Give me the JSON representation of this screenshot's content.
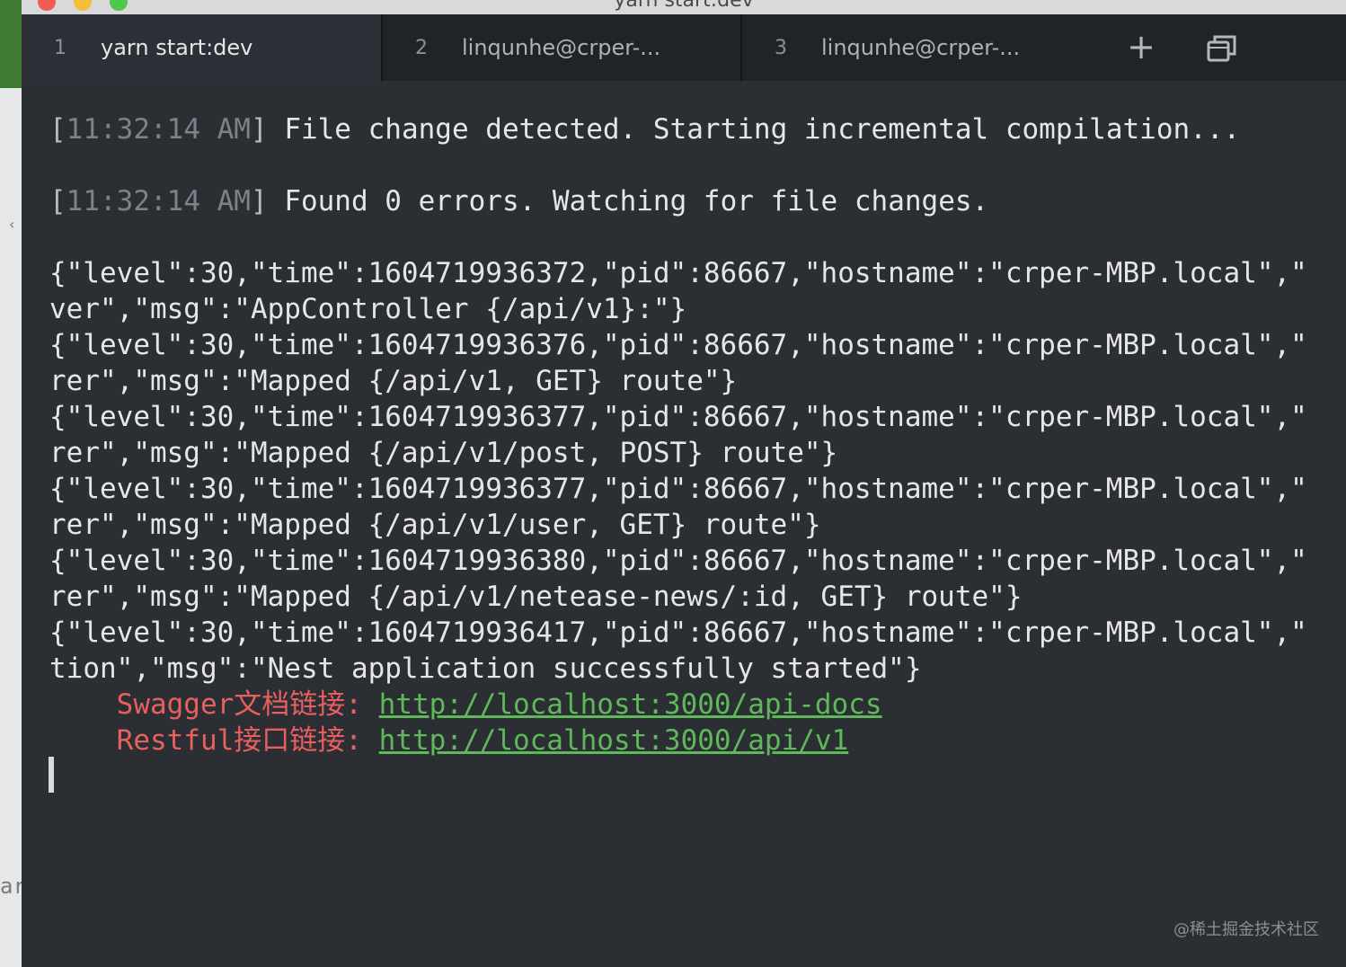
{
  "window": {
    "title": "yarn start:dev"
  },
  "tabs": [
    {
      "num": "1",
      "title": "yarn start:dev"
    },
    {
      "num": "2",
      "title": "linqunhe@crper-..."
    },
    {
      "num": "3",
      "title": "linqunhe@crper-..."
    }
  ],
  "icons": {
    "new_tab": "plus-icon",
    "window": "window-restore-icon"
  },
  "terminal": {
    "lines": [
      {
        "ts_open": "[",
        "ts_time": "11:32:14",
        "ts_ampm": " AM",
        "ts_close": "]",
        "text": " File change detected. Starting incremental compilation..."
      },
      {
        "ts_open": "[",
        "ts_time": "11:32:14",
        "ts_ampm": " AM",
        "ts_close": "]",
        "text": " Found 0 errors. Watching for file changes."
      },
      "{\"level\":30,\"time\":1604719936372,\"pid\":86667,\"hostname\":\"crper-MBP.local\",\"",
      "ver\",\"msg\":\"AppController {/api/v1}:\"}",
      "{\"level\":30,\"time\":1604719936376,\"pid\":86667,\"hostname\":\"crper-MBP.local\",\"",
      "rer\",\"msg\":\"Mapped {/api/v1, GET} route\"}",
      "{\"level\":30,\"time\":1604719936377,\"pid\":86667,\"hostname\":\"crper-MBP.local\",\"",
      "rer\",\"msg\":\"Mapped {/api/v1/post, POST} route\"}",
      "{\"level\":30,\"time\":1604719936377,\"pid\":86667,\"hostname\":\"crper-MBP.local\",\"",
      "rer\",\"msg\":\"Mapped {/api/v1/user, GET} route\"}",
      "{\"level\":30,\"time\":1604719936380,\"pid\":86667,\"hostname\":\"crper-MBP.local\",\"",
      "rer\",\"msg\":\"Mapped {/api/v1/netease-news/:id, GET} route\"}",
      "{\"level\":30,\"time\":1604719936417,\"pid\":86667,\"hostname\":\"crper-MBP.local\",\"",
      "tion\",\"msg\":\"Nest application successfully started\"}"
    ],
    "links": [
      {
        "label": "    Swagger文档链接: ",
        "url": "http://localhost:3000/api-docs"
      },
      {
        "label": "    Restful接口链接: ",
        "url": "http://localhost:3000/api/v1"
      }
    ]
  },
  "background": {
    "left_fragment": "ar"
  },
  "watermark": "@稀土掘金技术社区",
  "colors": {
    "terminal_bg": "#2b2f34",
    "tabbar_bg": "#202428",
    "active_tab_bg": "#2c3036",
    "label_red": "#e85f5f",
    "link_green": "#5fb85a"
  }
}
